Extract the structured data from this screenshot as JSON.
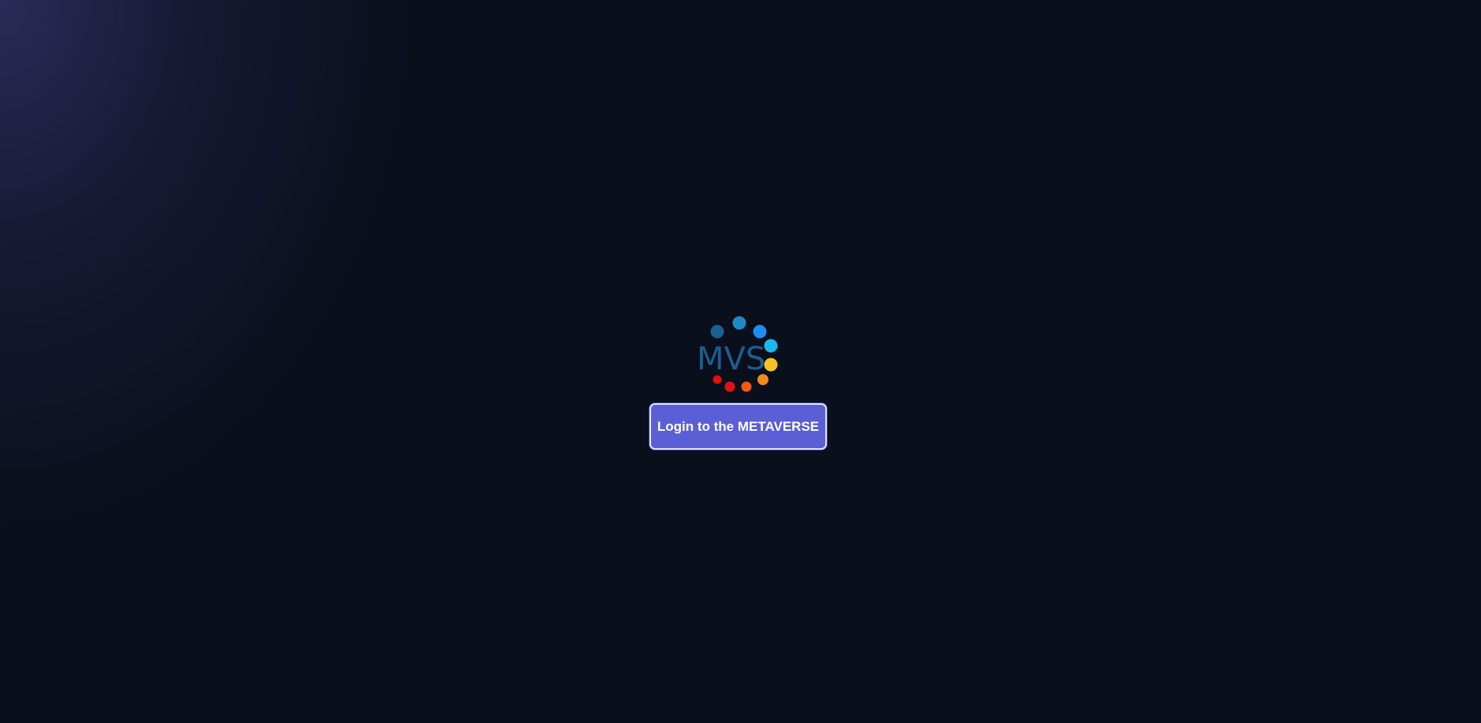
{
  "logo": {
    "text": "MVS",
    "icon": "mvs-dots-logo",
    "dot_colors": [
      "#1b5f93",
      "#1f8bc6",
      "#1d8ef0",
      "#1bb8ef",
      "#f6c327",
      "#f08a1d",
      "#f05a14",
      "#e11212",
      "#e60d0d"
    ]
  },
  "login_button": {
    "label": "Login to the METAVERSE"
  },
  "colors": {
    "background": "#0a0f1c",
    "button": "#5a5fd6",
    "button_border": "#dfe4ff"
  }
}
